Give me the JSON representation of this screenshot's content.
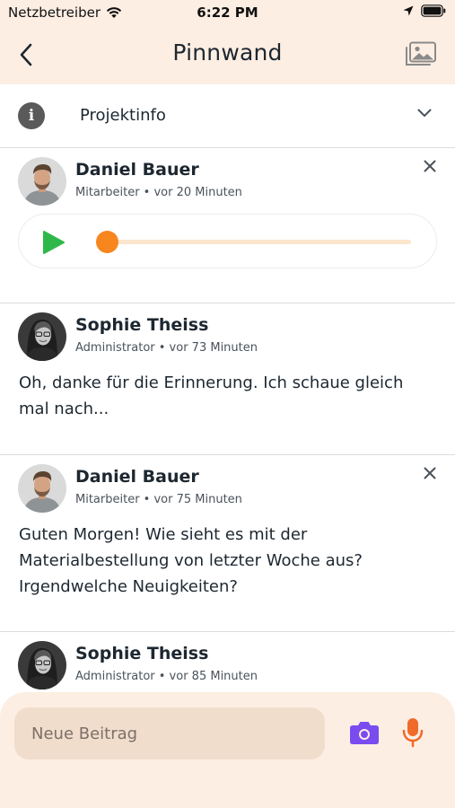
{
  "status_bar": {
    "carrier": "Netzbetreiber",
    "time": "6:22 PM"
  },
  "header": {
    "title": "Pinnwand"
  },
  "project_info": {
    "label": "Projektinfo"
  },
  "posts": [
    {
      "author": "Daniel Bauer",
      "meta": "Mitarbeiter • vor 20 Minuten",
      "type": "audio",
      "audio_progress": 0.0,
      "deletable": true
    },
    {
      "author": "Sophie Theiss",
      "meta": "Administrator • vor 73 Minuten",
      "type": "text",
      "text": "Oh, danke für die Erinnerung. Ich schaue gleich mal nach...",
      "deletable": false
    },
    {
      "author": "Daniel Bauer",
      "meta": "Mitarbeiter • vor 75 Minuten",
      "type": "text",
      "text": "Guten Morgen! Wie sieht es mit der Materialbestellung von letzter Woche aus? Irgendwelche Neuigkeiten?",
      "deletable": true
    },
    {
      "author": "Sophie Theiss",
      "meta": "Administrator • vor 85 Minuten",
      "type": "text",
      "text": "",
      "deletable": false
    }
  ],
  "composer": {
    "placeholder": "Neue Beitrag"
  },
  "icons": {
    "back": "chevron-left-icon",
    "gallery": "gallery-icon",
    "info": "info-icon",
    "expand": "chevron-down-icon",
    "close": "close-icon",
    "play": "play-icon",
    "camera": "camera-icon",
    "microphone": "microphone-icon"
  },
  "colors": {
    "header_bg": "#fdeee3",
    "accent_orange": "#f7861e",
    "play_green": "#2fb84a",
    "camera_purple": "#7a4cf0",
    "mic_orange": "#f06a2a"
  }
}
